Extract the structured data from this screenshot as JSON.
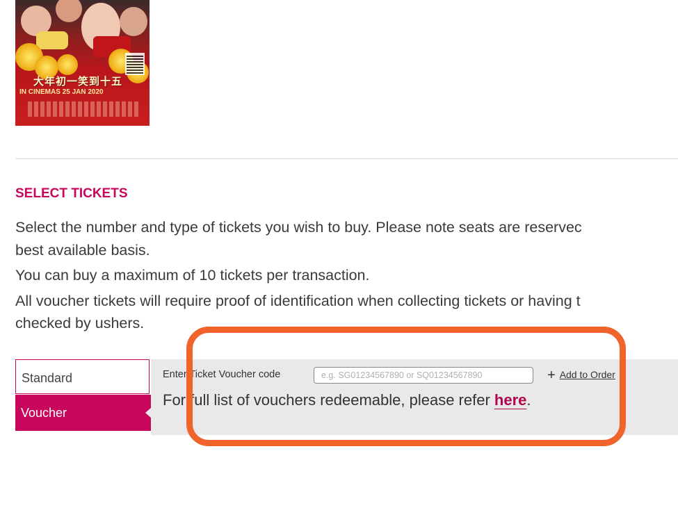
{
  "poster": {
    "title": "大年初一笑到十五",
    "date_text": "IN CINEMAS 25 JAN 2020"
  },
  "section": {
    "title": "SELECT TICKETS",
    "para1_line1": "Select the number and type of tickets you wish to buy. Please note seats are reservec",
    "para1_line2": "best available basis.",
    "para2": "You can buy a maximum of 10 tickets per transaction.",
    "para3_line1": "All voucher tickets will require proof of identification when collecting tickets or having t",
    "para3_line2": "checked by ushers."
  },
  "tabs": {
    "standard": "Standard",
    "voucher": "Voucher"
  },
  "voucher_panel": {
    "enter_label": "Enter Ticket Voucher code",
    "input_placeholder": "e.g. SG01234567890 or SQ01234567890",
    "input_value": "",
    "add_to_order": "Add to Order",
    "full_list_text": "For full list of vouchers redeemable, please refer ",
    "here_link": "here",
    "full_list_end": "."
  },
  "colors": {
    "accent": "#c7065c",
    "highlight": "#f0632a",
    "panel_bg": "#e9e9e9"
  }
}
